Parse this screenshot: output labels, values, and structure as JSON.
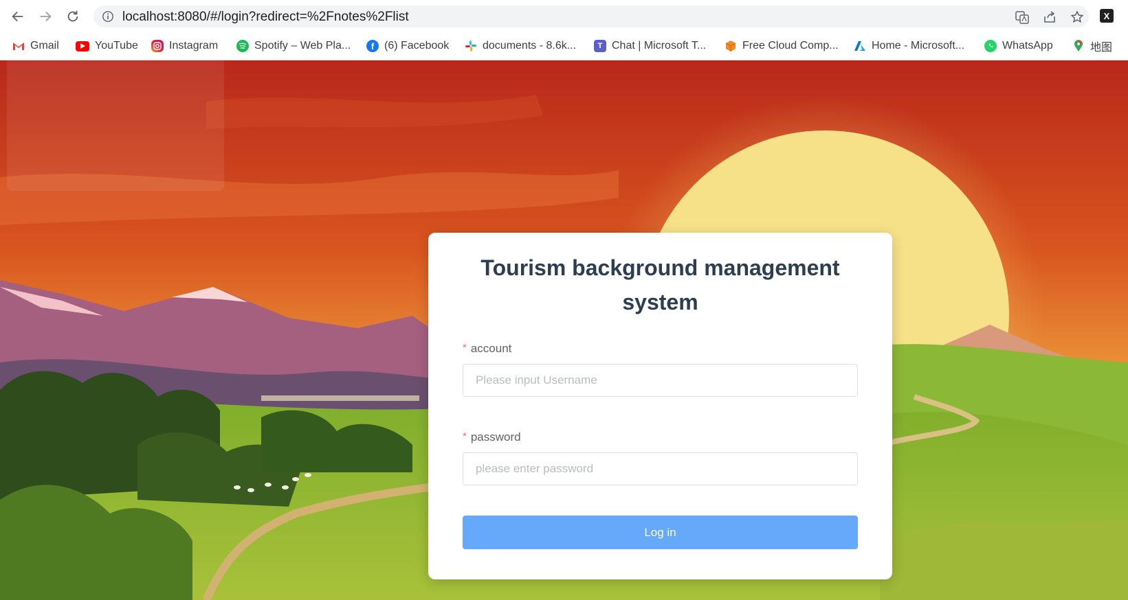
{
  "browser": {
    "url": "localhost:8080/#/login?redirect=%2Fnotes%2Flist",
    "bookmarks": [
      {
        "label": "Gmail",
        "icon": "gmail-icon",
        "color": "#ea4335"
      },
      {
        "label": "YouTube",
        "icon": "youtube-icon",
        "color": "#ff0000"
      },
      {
        "label": "Instagram",
        "icon": "instagram-icon",
        "color": "#d6249f"
      },
      {
        "label": "Spotify – Web Pla...",
        "icon": "spotify-icon",
        "color": "#1db954"
      },
      {
        "label": "(6) Facebook",
        "icon": "facebook-icon",
        "color": "#1877f2"
      },
      {
        "label": "documents - 8.6k...",
        "icon": "slack-icon",
        "color": "#e01e5a"
      },
      {
        "label": "Chat | Microsoft T...",
        "icon": "teams-icon",
        "color": "#5b5fc7"
      },
      {
        "label": "Free Cloud Comp...",
        "icon": "cube-icon",
        "color": "#f08a24"
      },
      {
        "label": "Home - Microsoft...",
        "icon": "azure-icon",
        "color": "#0078d4"
      },
      {
        "label": "WhatsApp",
        "icon": "whatsapp-icon",
        "color": "#25d366"
      },
      {
        "label": "地图",
        "icon": "maps-pin-icon",
        "color": "#34a853"
      }
    ]
  },
  "login": {
    "title": "Tourism background management system",
    "account_label": "account",
    "account_placeholder": "Please input Username",
    "password_label": "password",
    "password_placeholder": "please enter password",
    "submit_label": "Log in",
    "required_mark": "*"
  },
  "colors": {
    "primary_button": "#66a9fb",
    "title": "#2c3e50",
    "required": "#f56c6c"
  }
}
